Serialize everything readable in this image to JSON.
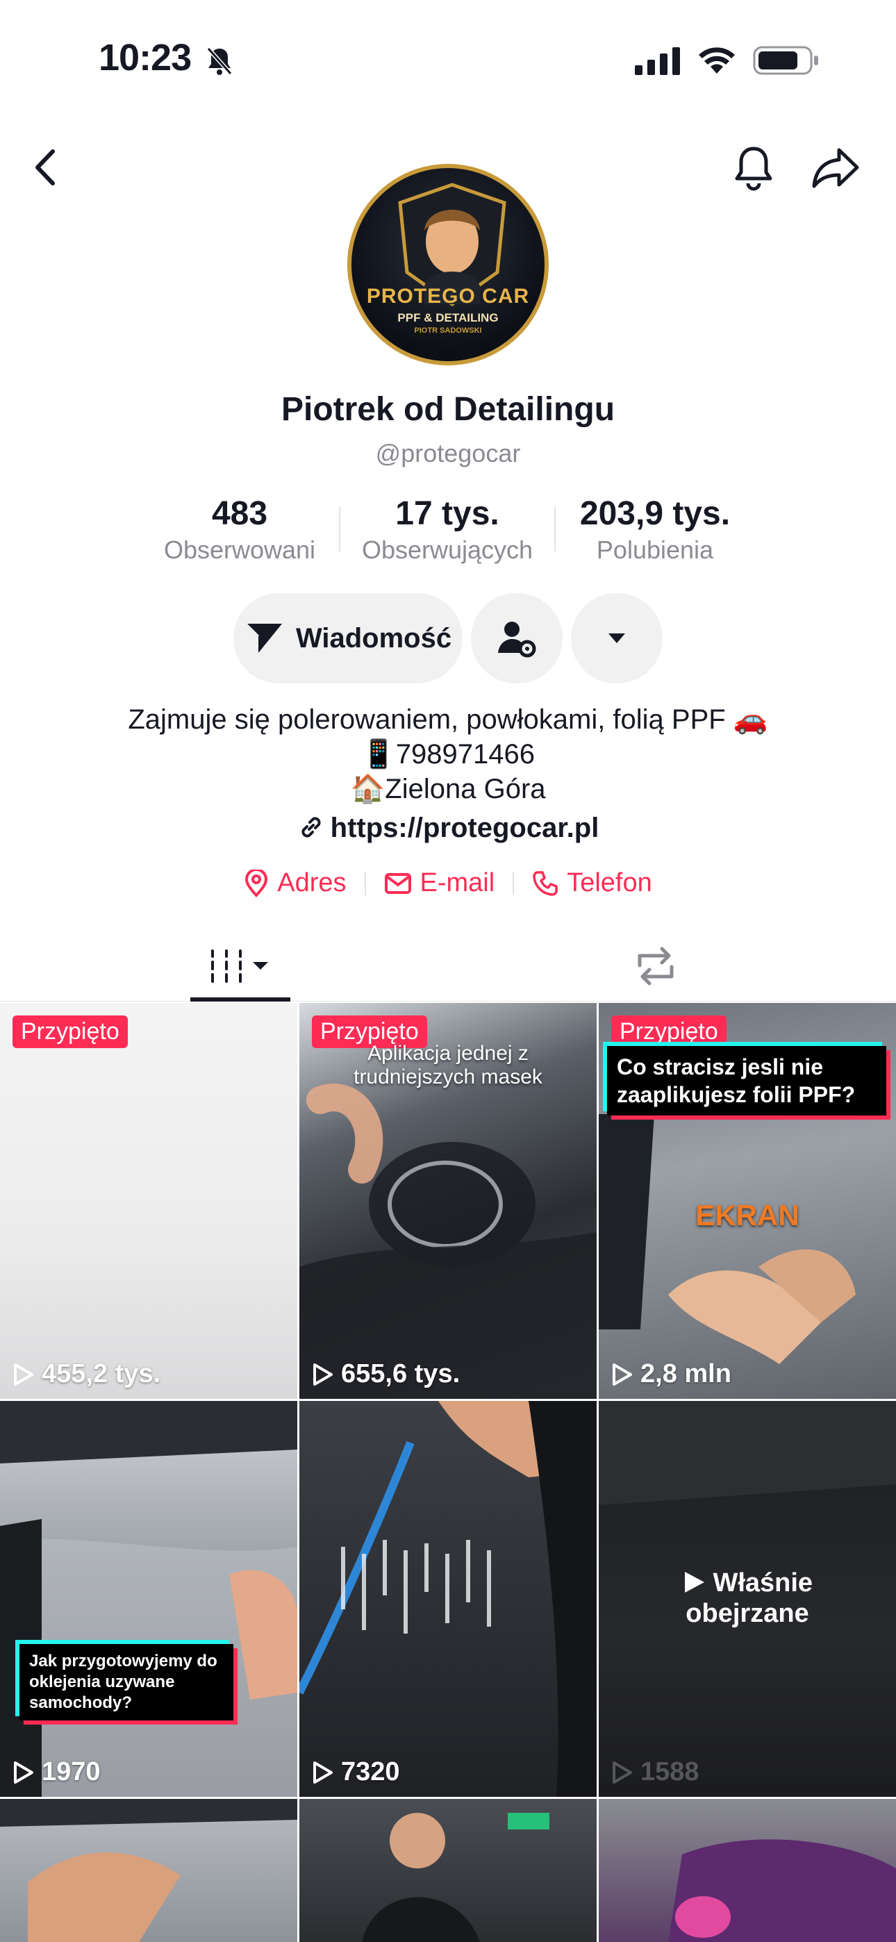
{
  "status_bar": {
    "time": "10:23"
  },
  "profile": {
    "name": "Piotrek od Detailingu",
    "handle": "@protegocar",
    "avatar": {
      "brand": "PROTEGO CAR",
      "subtitle": "PPF & DETAILING",
      "owner": "PIOTR SADOWSKI"
    }
  },
  "stats": [
    {
      "value": "483",
      "label": "Obserwowani"
    },
    {
      "value": "17 tys.",
      "label": "Obserwujących"
    },
    {
      "value": "203,9 tys.",
      "label": "Polubienia"
    }
  ],
  "actions": {
    "message_label": "Wiadomość"
  },
  "bio": {
    "line1": "Zajmuje się polerowaniem, powłokami, folią PPF 🚗",
    "line2": "📱798971466",
    "line3": "🏠Zielona Góra",
    "link": "https://protegocar.pl"
  },
  "contacts": [
    {
      "label": "Adres",
      "icon": "location-pin-icon"
    },
    {
      "label": "E-mail",
      "icon": "mail-icon"
    },
    {
      "label": "Telefon",
      "icon": "phone-icon"
    }
  ],
  "colors": {
    "accent": "#fe2c55",
    "text": "#161823",
    "muted": "#8a8b91",
    "button_bg": "#f1f1f2"
  },
  "videos": [
    {
      "pinned_label": "Przypięto",
      "views": "455,2 tys."
    },
    {
      "pinned_label": "Przypięto",
      "views": "655,6 tys.",
      "title": "Aplikacja jednej z trudniejszych masek"
    },
    {
      "pinned_label": "Przypięto",
      "views": "2,8 mln",
      "title": "Co stracisz jesli nie zaaplikujesz folii PPF?",
      "overlay_word": "EKRAN"
    },
    {
      "views": "1970",
      "title": "Jak przygotowyjemy do oklejenia uzywane samochody?"
    },
    {
      "views": "7320"
    },
    {
      "views": "1588",
      "watched_label_1": "Właśnie",
      "watched_label_2": "obejrzane"
    }
  ]
}
